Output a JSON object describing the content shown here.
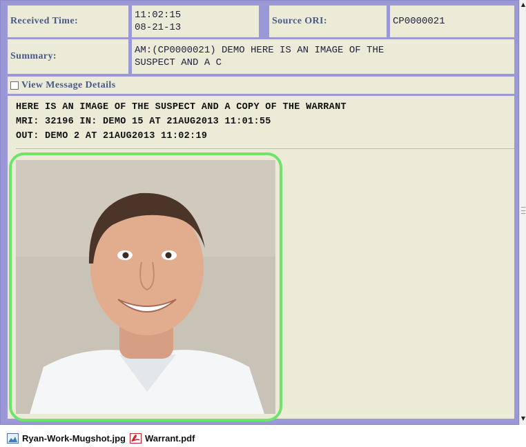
{
  "header": {
    "received_time_label": "Received Time:",
    "received_time": "11:02:15",
    "received_date": "08-21-13",
    "source_ori_label": "Source ORI:",
    "source_ori": "CP0000021",
    "summary_label": "Summary:",
    "summary_line1": "AM:(CP0000021) DEMO HERE IS AN IMAGE OF THE",
    "summary_line2": "SUSPECT AND A C"
  },
  "details_toggle": {
    "label": "View Message Details",
    "checked": false
  },
  "message": {
    "lines": [
      "HERE IS AN IMAGE OF THE SUSPECT AND A COPY OF THE WARRANT",
      "MRI: 32196 IN: DEMO 15 AT 21AUG2013 11:01:55",
      "OUT: DEMO 2 AT 21AUG2013 11:02:19"
    ]
  },
  "image": {
    "highlight_color": "#6fe36a",
    "icon": "mugshot-photo"
  },
  "attachments": [
    {
      "name": "Ryan-Work-Mugshot.jpg",
      "icon": "image-file-icon"
    },
    {
      "name": "Warrant.pdf",
      "icon": "pdf-file-icon"
    }
  ],
  "colors": {
    "frame": "#9a98d6",
    "panel": "#ecebd8",
    "label": "#4a5a88"
  }
}
